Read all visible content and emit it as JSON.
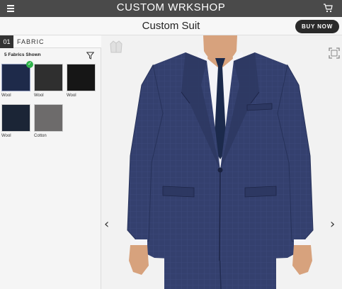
{
  "header": {
    "brand": "CUSTOM WRKSHOP",
    "menu_icon": "hamburger-menu-icon",
    "cart_icon": "cart-icon"
  },
  "subheader": {
    "title": "Custom Suit",
    "buy_label": "BUY NOW"
  },
  "panel": {
    "step_number": "01",
    "step_label": "FABRIC",
    "count_label": "5 Fabrics Shown",
    "swatches": [
      {
        "label": "Wool",
        "color": "#1e2a4a",
        "selected": true
      },
      {
        "label": "Wool",
        "color": "#2f2f2f",
        "selected": false
      },
      {
        "label": "Wool",
        "color": "#161616",
        "selected": false
      },
      {
        "label": "Wool",
        "color": "#1b2536",
        "selected": false
      },
      {
        "label": "Cotton",
        "color": "#6d6b6b",
        "selected": false
      }
    ]
  },
  "viewer": {
    "prev_arrow": "‹",
    "next_arrow": "›",
    "colors": {
      "suit": "#34406e",
      "shirt": "#f4f4f8",
      "tie": "#1c2a4c",
      "skin": "#d7a27d"
    }
  }
}
